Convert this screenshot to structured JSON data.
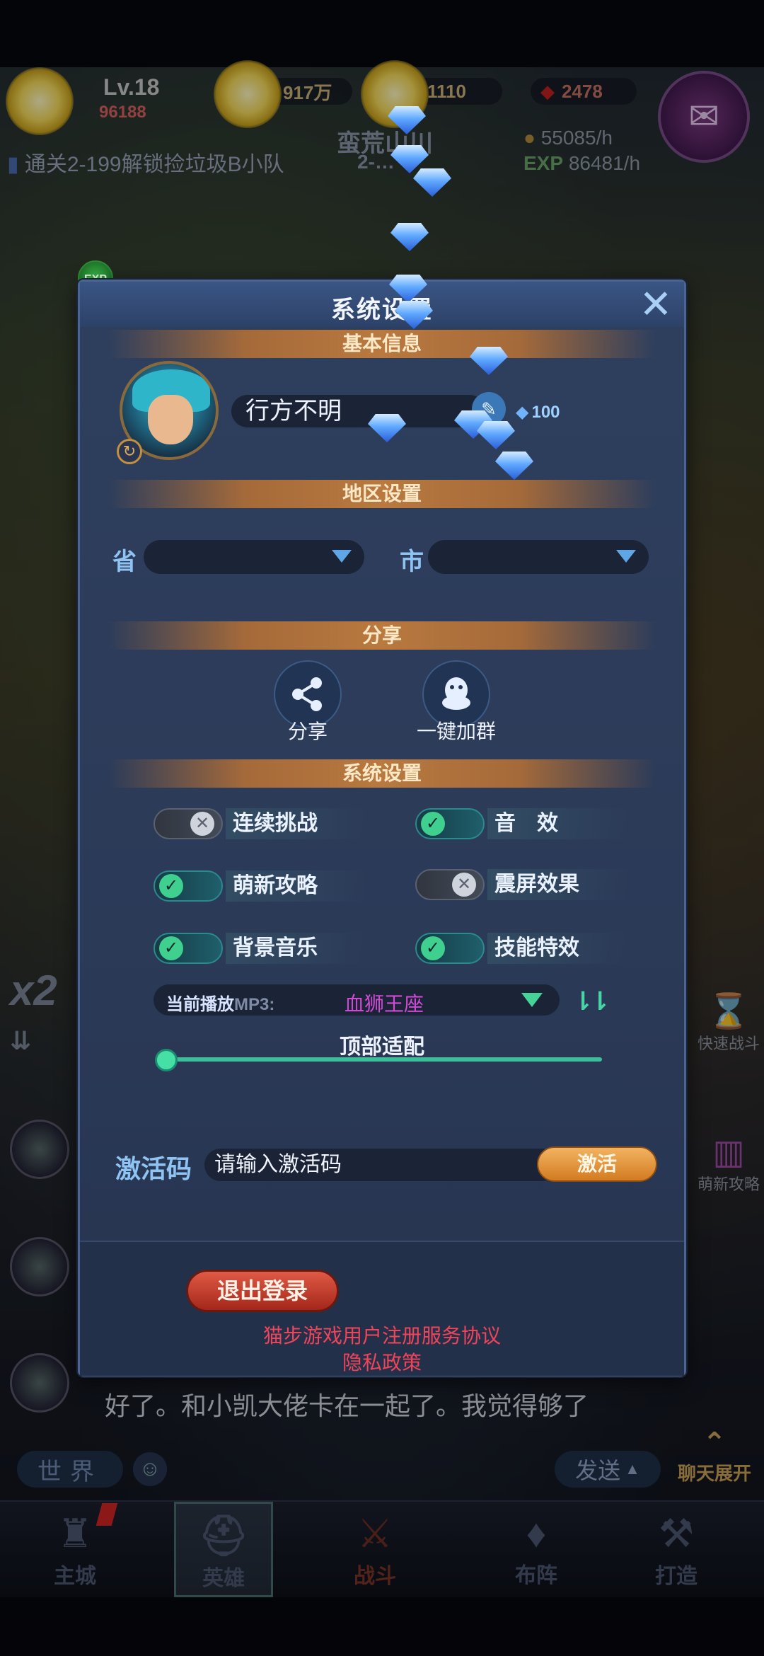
{
  "hud": {
    "level": "Lv.18",
    "power": "96188",
    "gold": "917万",
    "diamonds": "1110",
    "rubies": "2478",
    "quest": "通关2-199解锁捡垃圾B小队",
    "stage_name": "蛮荒山川",
    "stage_number": "2-…",
    "gold_rate": "55085/h",
    "exp_label": "EXP",
    "exp_rate": "86481/h",
    "scroll_icon": "scroll-icon"
  },
  "side": {
    "speed": "x2",
    "quick_battle": "快速战斗",
    "newbie_guide": "萌新攻略",
    "exp_badge": "EXP"
  },
  "chat": {
    "message": "好了。和小凯大佬卡在一起了。我觉得够了",
    "world_tab": "世界",
    "send_label": "发送",
    "expand_label": "聊天展开"
  },
  "nav": [
    {
      "label": "主城",
      "icon": "castle-icon"
    },
    {
      "label": "英雄",
      "icon": "helmet-icon"
    },
    {
      "label": "战斗",
      "icon": "crossed-swords-icon"
    },
    {
      "label": "布阵",
      "icon": "formation-icon"
    },
    {
      "label": "打造",
      "icon": "anvil-icon"
    }
  ],
  "dialog": {
    "title": "系统设置",
    "close_icon": "close-icon",
    "basic_info": {
      "section": "基本信息",
      "player_name": "行方不明",
      "rename_cost": "100"
    },
    "region": {
      "section": "地区设置",
      "province_label": "省",
      "province_value": "",
      "city_label": "市",
      "city_value": ""
    },
    "share": {
      "section": "分享",
      "share_label": "分享",
      "join_group_label": "一键加群"
    },
    "system": {
      "section": "系统设置",
      "toggles": [
        {
          "label": "连续挑战",
          "on": false
        },
        {
          "label": "音　效",
          "on": true
        },
        {
          "label": "萌新攻略",
          "on": true
        },
        {
          "label": "震屏效果",
          "on": false
        },
        {
          "label": "背景音乐",
          "on": true
        },
        {
          "label": "技能特效",
          "on": true
        }
      ],
      "now_playing_prefix": "当前播放",
      "now_playing_format": "MP3:",
      "now_playing_track": "血狮王座",
      "top_adapt_label": "顶部适配",
      "top_adapt_value": 0
    },
    "activation": {
      "label": "激活码",
      "placeholder": "请输入激活码",
      "button": "激活"
    },
    "logout": "退出登录",
    "terms": "猫步游戏用户注册服务协议",
    "privacy": "隐私政策"
  },
  "colors": {
    "panel": "#2b3a57",
    "section_bar": "#b9793f",
    "toggle_on": "#3fcf8e",
    "link_red": "#f0445a",
    "track_magenta": "#d04ad6"
  }
}
